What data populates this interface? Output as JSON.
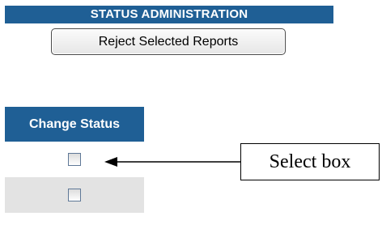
{
  "header": {
    "title": "STATUS ADMINISTRATION"
  },
  "toolbar": {
    "reject_button_label": "Reject Selected Reports"
  },
  "table": {
    "column_header": "Change Status",
    "rows": [
      {
        "checked": false
      },
      {
        "checked": false
      }
    ]
  },
  "callout": {
    "label": "Select box"
  },
  "colors": {
    "header_background": "#1f5f95",
    "header_text": "#ffffff",
    "alternate_row": "#e3e3e3"
  }
}
